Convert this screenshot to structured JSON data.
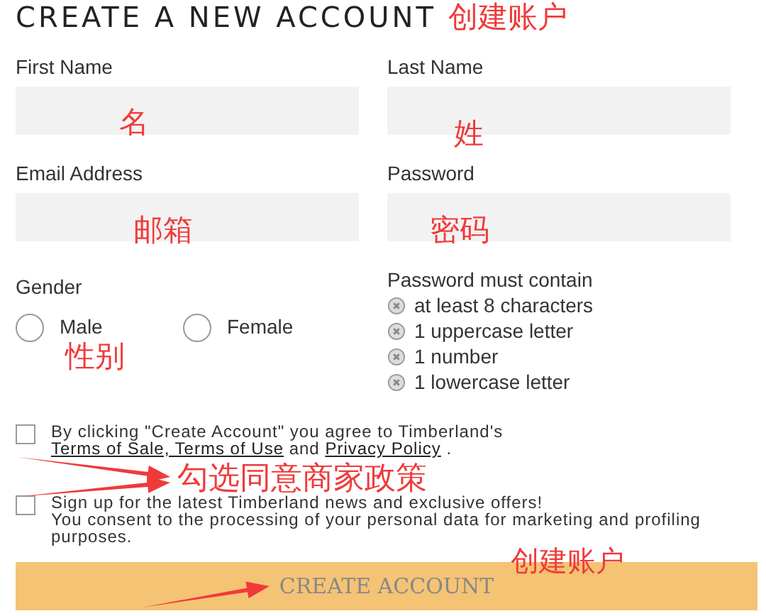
{
  "title": "CREATE A NEW ACCOUNT",
  "fields": [
    {
      "label": "First Name"
    },
    {
      "label": "Last Name"
    },
    {
      "label": "Email Address"
    },
    {
      "label": "Password"
    }
  ],
  "gender": {
    "label": "Gender",
    "options": [
      {
        "label": "Male",
        "selected": false
      },
      {
        "label": "Female",
        "selected": false
      }
    ]
  },
  "password_rules": {
    "heading": "Password must contain",
    "items": [
      {
        "text": "at least 8 characters",
        "met": false
      },
      {
        "text": "1 uppercase letter",
        "met": false
      },
      {
        "text": "1 number",
        "met": false
      },
      {
        "text": "1 lowercase letter",
        "met": false
      }
    ]
  },
  "agreements": [
    {
      "checked": false,
      "text": "By clicking \"Create Account\" you agree to Timberland's ",
      "links": [
        "Terms of Sale, Terms of Use",
        "Privacy Policy"
      ],
      "joiner": " and ",
      "suffix": " ."
    },
    {
      "checked": false,
      "text": "Sign up for the latest Timberland news and exclusive offers!",
      "note": "You consent to the processing of your personal data for marketing and profiling purposes."
    }
  ],
  "button": "CREATE ACCOUNT",
  "annotations": [
    {
      "text": "创建账户"
    },
    {
      "text": "名"
    },
    {
      "text": "姓"
    },
    {
      "text": "邮箱"
    },
    {
      "text": "密码"
    },
    {
      "text": "性别"
    },
    {
      "text": "勾选同意商家政策"
    },
    {
      "text": "创建账户"
    }
  ]
}
